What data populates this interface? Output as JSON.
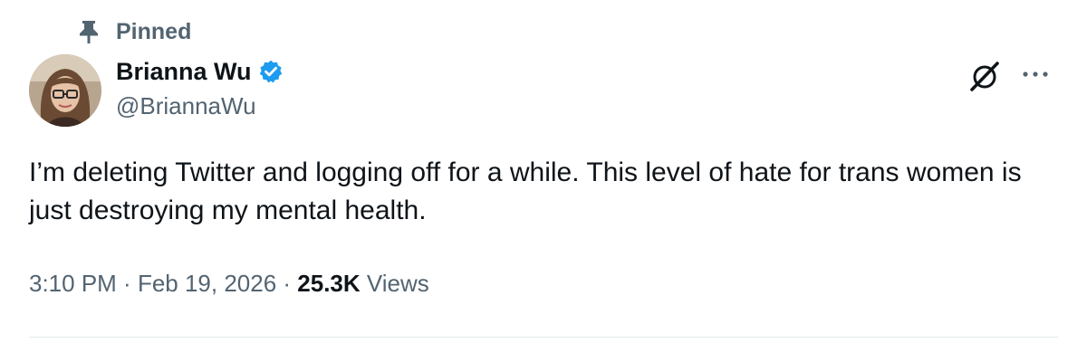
{
  "pinned": {
    "icon": "pin-icon",
    "label": "Pinned"
  },
  "author": {
    "avatar_icon": "avatar",
    "display_name": "Brianna Wu",
    "verified_icon": "verified-badge-icon",
    "verified_color": "#1d9bf0",
    "handle": "@BriannaWu"
  },
  "actions": {
    "grok_icon": "grok-icon",
    "more_icon": "more-options-icon"
  },
  "tweet": {
    "text": "I’m deleting Twitter and logging off for a while. This level of hate for trans women is just destroying my mental health."
  },
  "meta": {
    "time": "3:10 PM",
    "separator": " · ",
    "date": "Feb 19, 2026",
    "views_count": "25.3K",
    "views_label": " Views"
  },
  "colors": {
    "text_primary": "#0f1419",
    "text_secondary": "#536471",
    "divider": "#e1e8ed"
  }
}
